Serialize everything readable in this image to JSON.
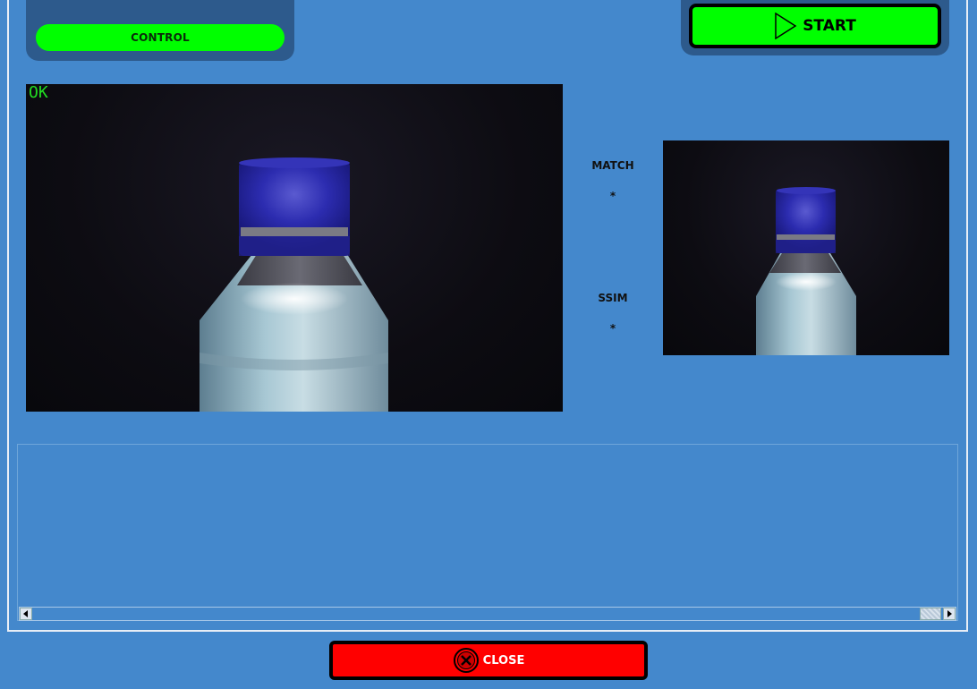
{
  "control_panel": {
    "control_label": "CONTROL"
  },
  "toolbar": {
    "start_label": "START"
  },
  "main_camera": {
    "status": "OK",
    "status_color": "#22dd22"
  },
  "metrics": {
    "match_label": "MATCH",
    "match_value": "*",
    "ssim_label": "SSIM",
    "ssim_value": "*"
  },
  "footer": {
    "close_label": "CLOSE"
  },
  "colors": {
    "background": "#4488cc",
    "panel": "#2d5a8c",
    "start_button": "#00ff00",
    "close_button": "#ff0000",
    "cap": "#2a2aa0",
    "bottle": "#8fb0c0"
  }
}
